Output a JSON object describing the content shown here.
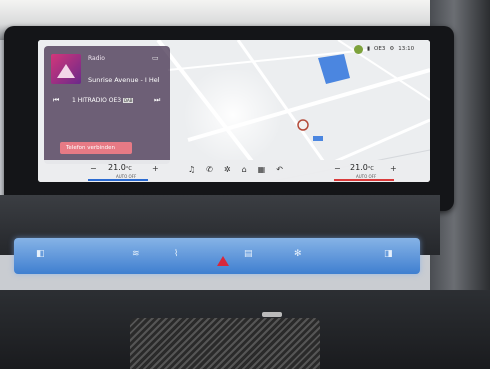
{
  "media": {
    "source_label": "Radio",
    "track_title": "Sunrise Avenue - I Hel",
    "station": "1 HITRADIO OE3",
    "station_badge": "DAB",
    "prev_icon": "skip-back-icon",
    "next_icon": "skip-forward-icon",
    "connect_label": "Telefon verbinden"
  },
  "status": {
    "signal": "OE3",
    "time": "13:10"
  },
  "climate": {
    "left_temp": "21.0",
    "left_unit": "°C",
    "left_mode": "AUTO OFF",
    "right_temp": "21.0",
    "right_unit": "°C",
    "right_mode": "AUTO OFF",
    "minus": "−",
    "plus": "+"
  },
  "nav_icons": [
    "music-icon",
    "phone-icon",
    "fan-icon",
    "home-icon",
    "grid-icon",
    "back-icon"
  ],
  "colors": {
    "accent_blue": "#2b6bd1",
    "accent_red": "#d93b3b",
    "connect_button": "#e77a85",
    "map_water": "#4b86e0"
  }
}
